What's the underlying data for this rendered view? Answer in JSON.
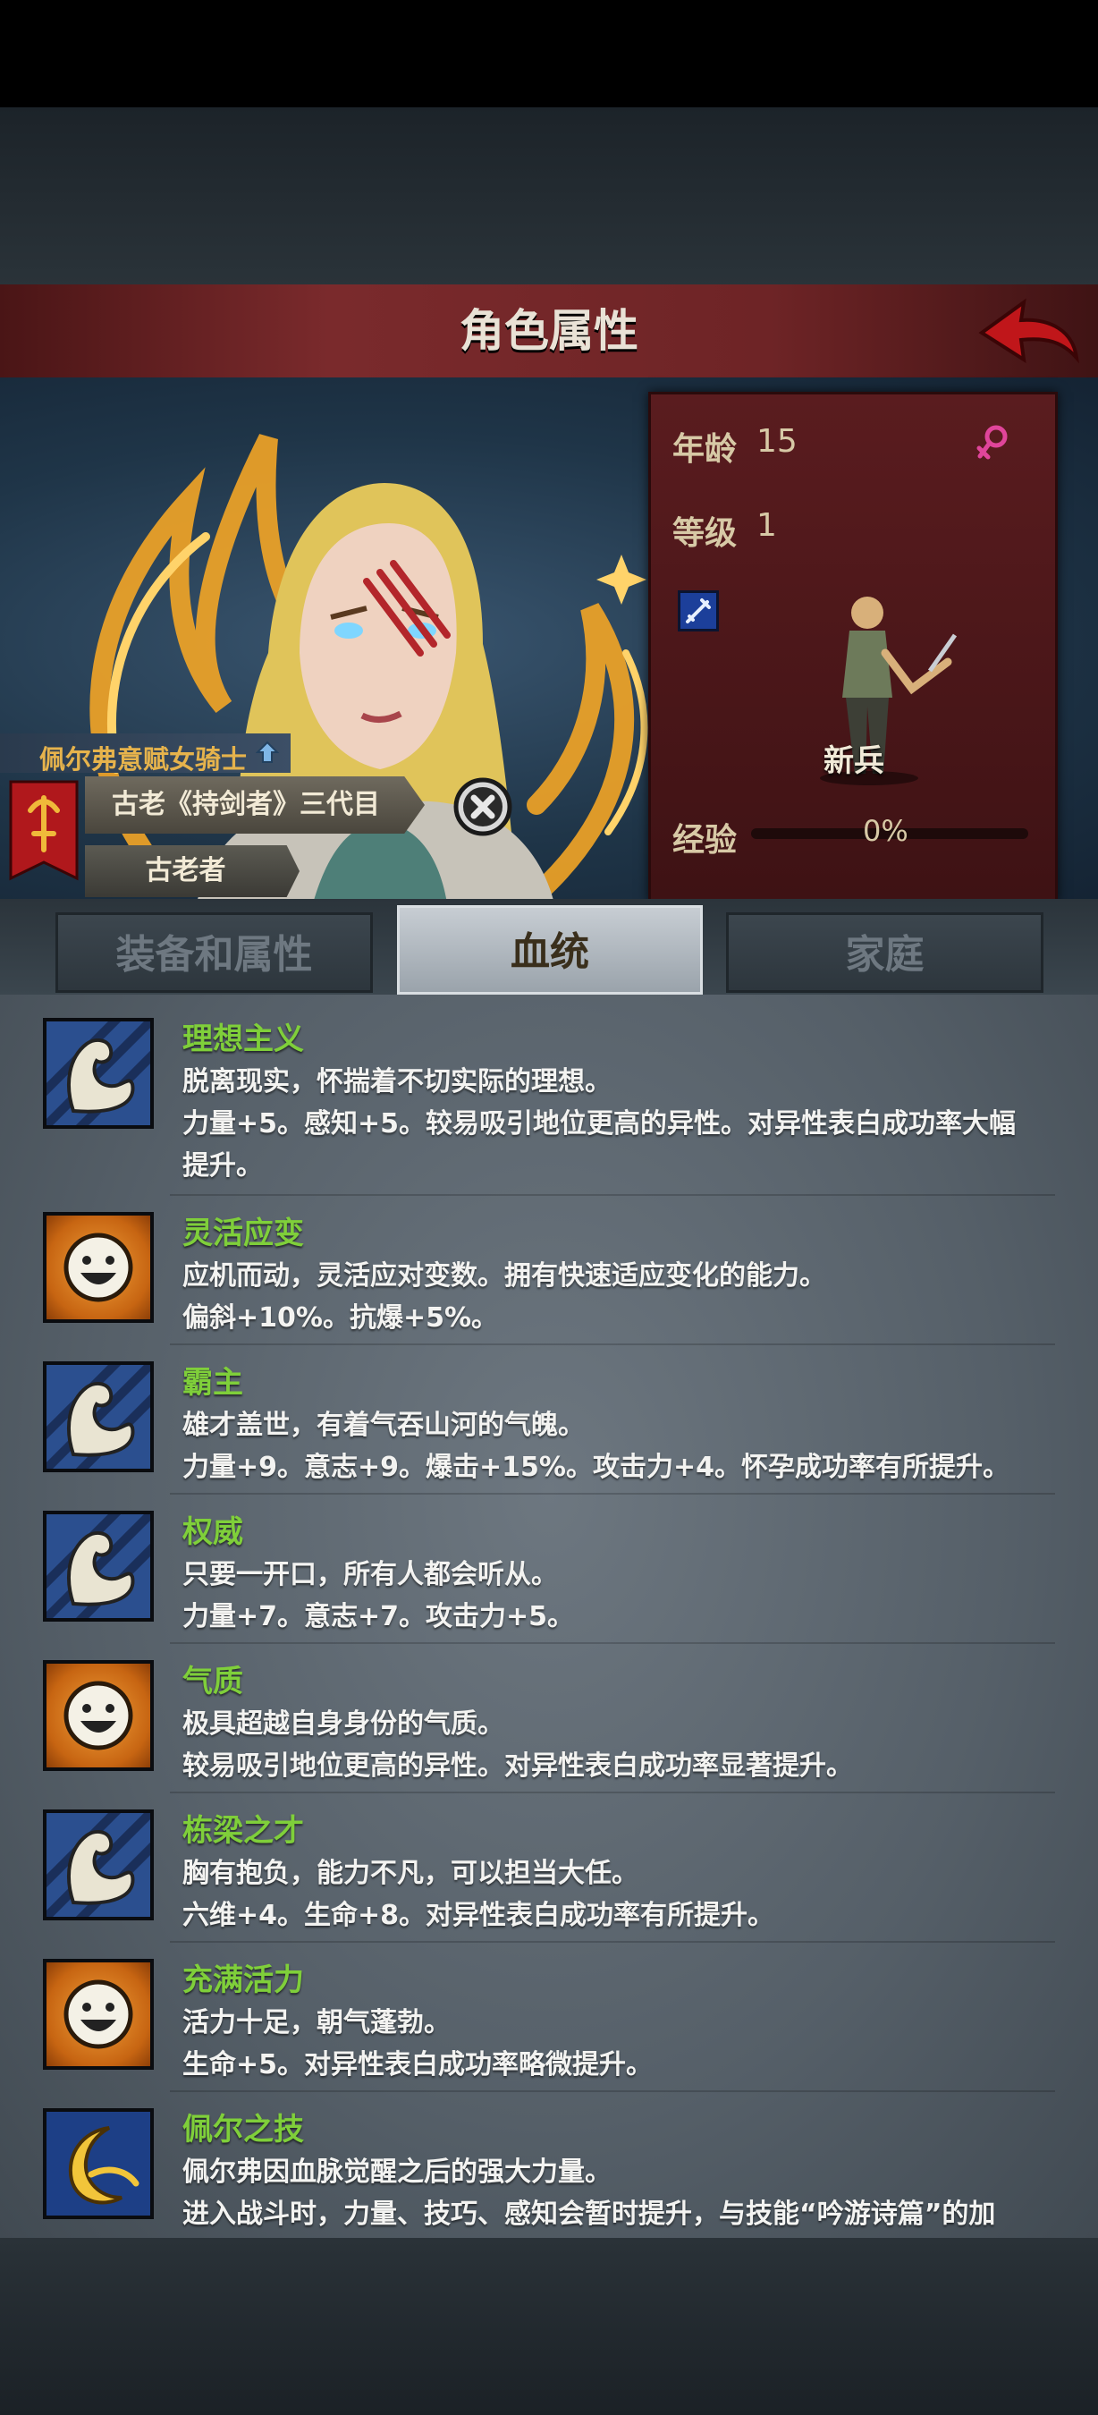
{
  "header": {
    "title": "角色属性"
  },
  "character": {
    "name": "佩尔弗意赋女骑士",
    "title": "古老《持剑者》三代目",
    "subtitle": "古老者",
    "age_label": "年龄",
    "age": "15",
    "level_label": "等级",
    "level": "1",
    "rank": "新兵",
    "exp_label": "经验",
    "exp": "0%",
    "exp_progress": 0
  },
  "tabs": [
    {
      "label": "装备和属性",
      "active": false
    },
    {
      "label": "血统",
      "active": true
    },
    {
      "label": "家庭",
      "active": false
    }
  ],
  "traits": [
    {
      "icon": "flexed-arm-icon",
      "name": "理想主义",
      "lines": [
        "脱离现实，怀揣着不切实际的理想。",
        "力量+5。感知+5。较易吸引地位更高的异性。对异性表白成功率大幅",
        "提升。"
      ]
    },
    {
      "icon": "smiley-face-icon",
      "name": "灵活应变",
      "lines": [
        "应机而动，灵活应对变数。拥有快速适应变化的能力。",
        "偏斜+10%。抗爆+5%。"
      ]
    },
    {
      "icon": "flexed-arm-icon",
      "name": "霸主",
      "lines": [
        "雄才盖世，有着气吞山河的气魄。",
        "力量+9。意志+9。爆击+15%。攻击力+4。怀孕成功率有所提升。"
      ]
    },
    {
      "icon": "flexed-arm-icon",
      "name": "权威",
      "lines": [
        "只要一开口，所有人都会听从。",
        "力量+7。意志+7。攻击力+5。"
      ]
    },
    {
      "icon": "smiley-face-icon",
      "name": "气质",
      "lines": [
        "极具超越自身身份的气质。",
        "较易吸引地位更高的异性。对异性表白成功率显著提升。"
      ]
    },
    {
      "icon": "flexed-arm-icon",
      "name": "栋梁之才",
      "lines": [
        "胸有抱负，能力不凡，可以担当大任。",
        "六维+4。生命+8。对异性表白成功率有所提升。"
      ]
    },
    {
      "icon": "smiley-face-icon",
      "name": "充满活力",
      "lines": [
        "活力十足，朝气蓬勃。",
        "生命+5。对异性表白成功率略微提升。"
      ]
    },
    {
      "icon": "crescent-moon-icon",
      "name": "佩尔之技",
      "lines": [
        "佩尔弗因血脉觉醒之后的强大力量。",
        "进入战斗时，力量、技巧、感知会暂时提升，与技能“吟游诗篇”的加"
      ]
    }
  ]
}
